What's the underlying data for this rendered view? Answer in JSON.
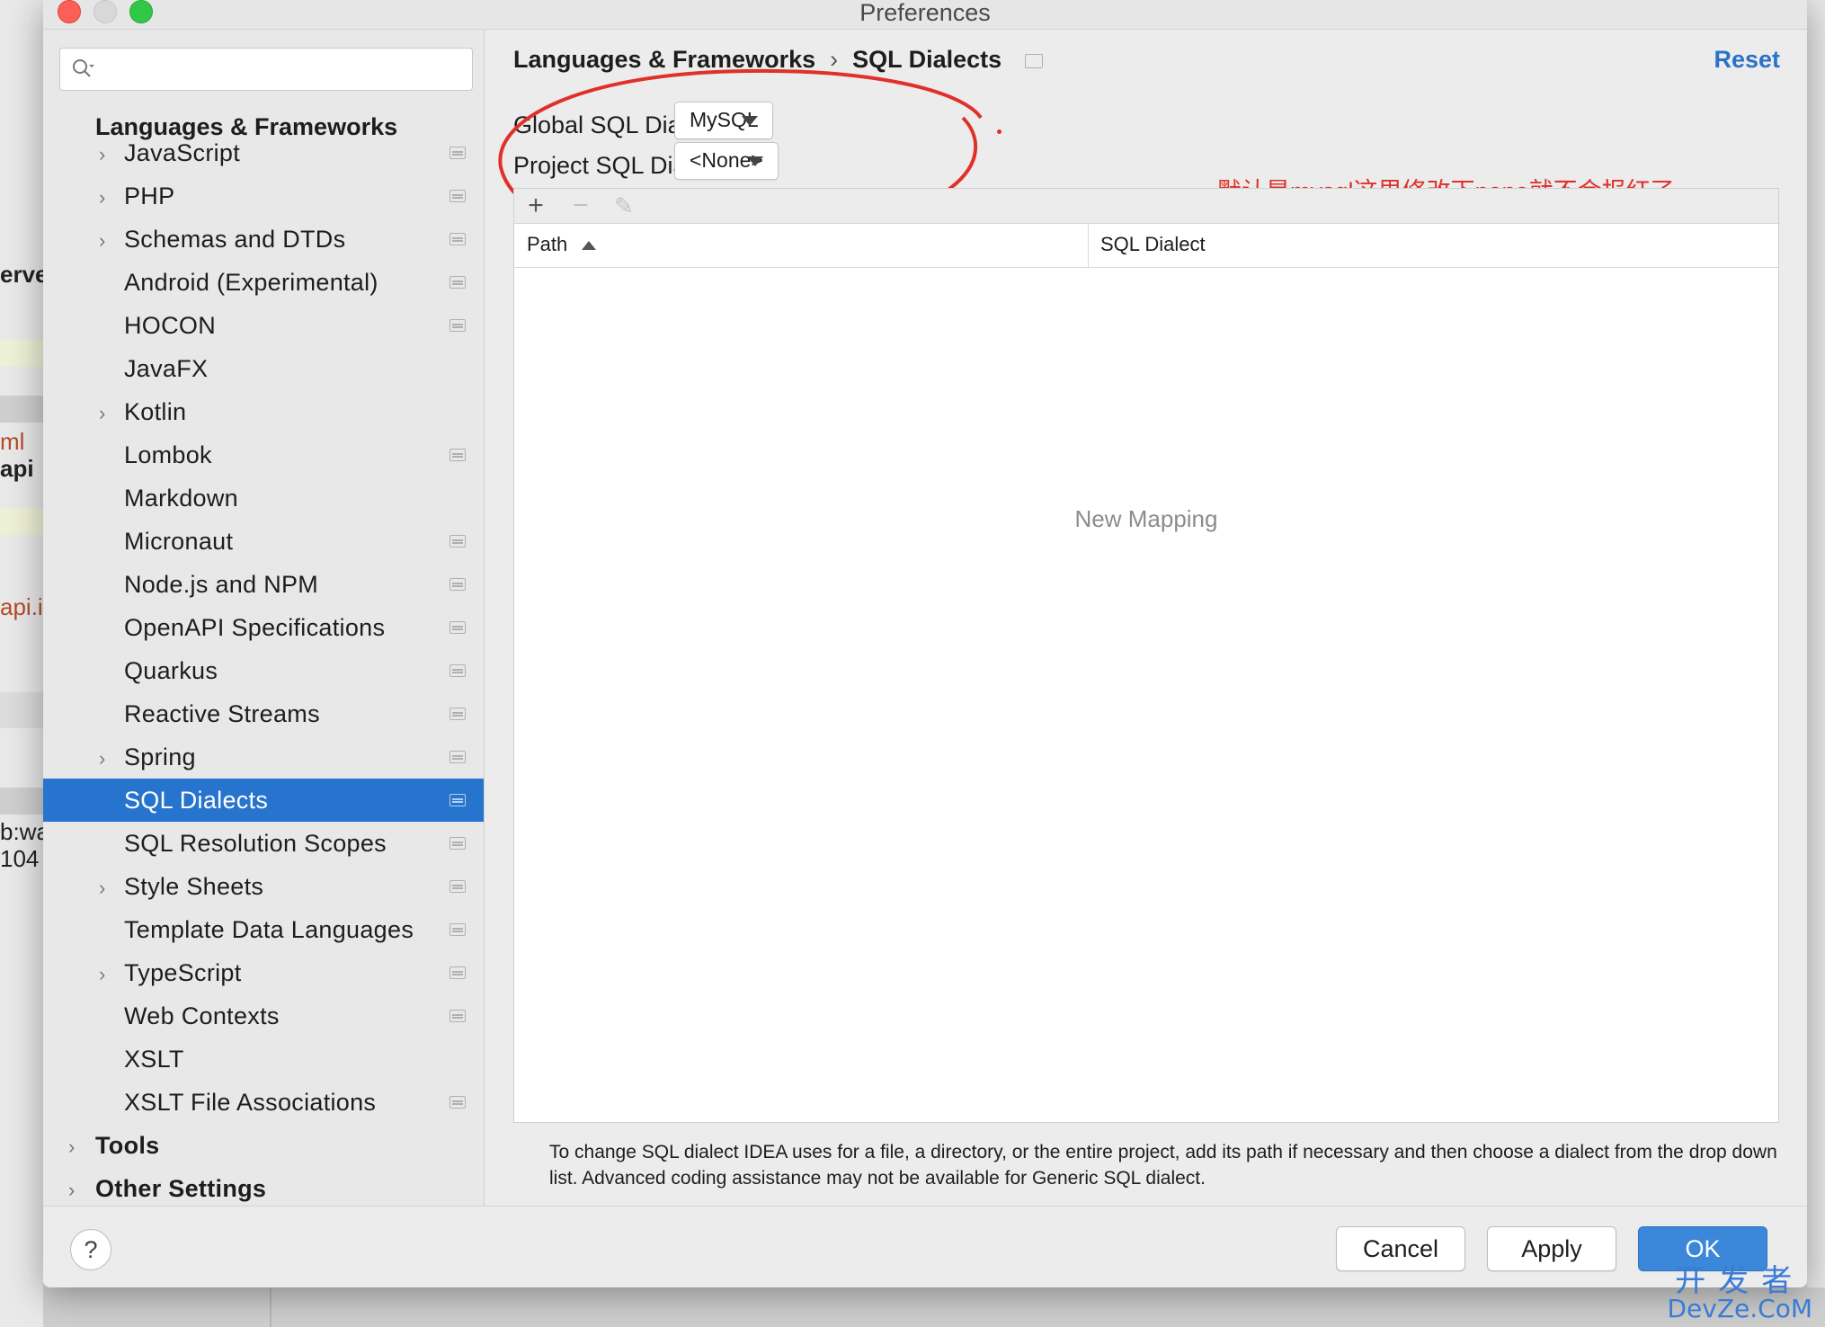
{
  "window": {
    "title": "Preferences"
  },
  "background_fragments": [
    "erve",
    "ml",
    "api",
    "api.i",
    "b:wa",
    "104"
  ],
  "sidebar": {
    "search": {
      "placeholder": ""
    },
    "section_title": "Languages & Frameworks",
    "items": [
      {
        "label": "JavaScript",
        "chevron": true,
        "page_icon": true,
        "selected": false
      },
      {
        "label": "PHP",
        "chevron": true,
        "page_icon": true,
        "selected": false
      },
      {
        "label": "Schemas and DTDs",
        "chevron": true,
        "page_icon": true,
        "selected": false
      },
      {
        "label": "Android (Experimental)",
        "chevron": false,
        "page_icon": true,
        "selected": false
      },
      {
        "label": "HOCON",
        "chevron": false,
        "page_icon": true,
        "selected": false
      },
      {
        "label": "JavaFX",
        "chevron": false,
        "page_icon": false,
        "selected": false
      },
      {
        "label": "Kotlin",
        "chevron": true,
        "page_icon": false,
        "selected": false
      },
      {
        "label": "Lombok",
        "chevron": false,
        "page_icon": true,
        "selected": false
      },
      {
        "label": "Markdown",
        "chevron": false,
        "page_icon": false,
        "selected": false
      },
      {
        "label": "Micronaut",
        "chevron": false,
        "page_icon": true,
        "selected": false
      },
      {
        "label": "Node.js and NPM",
        "chevron": false,
        "page_icon": true,
        "selected": false
      },
      {
        "label": "OpenAPI Specifications",
        "chevron": false,
        "page_icon": true,
        "selected": false
      },
      {
        "label": "Quarkus",
        "chevron": false,
        "page_icon": true,
        "selected": false
      },
      {
        "label": "Reactive Streams",
        "chevron": false,
        "page_icon": true,
        "selected": false
      },
      {
        "label": "Spring",
        "chevron": true,
        "page_icon": true,
        "selected": false
      },
      {
        "label": "SQL Dialects",
        "chevron": false,
        "page_icon": true,
        "selected": true
      },
      {
        "label": "SQL Resolution Scopes",
        "chevron": false,
        "page_icon": true,
        "selected": false
      },
      {
        "label": "Style Sheets",
        "chevron": true,
        "page_icon": true,
        "selected": false
      },
      {
        "label": "Template Data Languages",
        "chevron": false,
        "page_icon": true,
        "selected": false
      },
      {
        "label": "TypeScript",
        "chevron": true,
        "page_icon": true,
        "selected": false
      },
      {
        "label": "Web Contexts",
        "chevron": false,
        "page_icon": true,
        "selected": false
      },
      {
        "label": "XSLT",
        "chevron": false,
        "page_icon": false,
        "selected": false
      },
      {
        "label": "XSLT File Associations",
        "chevron": false,
        "page_icon": true,
        "selected": false
      }
    ],
    "top_level_items": [
      {
        "label": "Tools"
      },
      {
        "label": "Other Settings"
      }
    ]
  },
  "main": {
    "breadcrumb": {
      "parent": "Languages & Frameworks",
      "separator": "›",
      "current": "SQL Dialects"
    },
    "reset_label": "Reset",
    "global_dialect": {
      "label": "Global SQL Dialect:",
      "value": "MySQL"
    },
    "project_dialect": {
      "label": "Project SQL Dialect:",
      "value": "<None>"
    },
    "annotation_text": "默认是mysql这里修改下none就不会报红了",
    "table": {
      "toolbar": {
        "add": "+",
        "remove": "−",
        "edit": "✎"
      },
      "columns": [
        "Path",
        "SQL Dialect"
      ],
      "sort_column": "Path",
      "empty_text": "New Mapping"
    },
    "help_text": "To change SQL dialect IDEA uses for a file, a directory, or the entire project, add its path if necessary and then choose a dialect from the drop down list. Advanced coding assistance may not be available for Generic SQL dialect."
  },
  "footer": {
    "help_label": "?",
    "cancel_label": "Cancel",
    "apply_label": "Apply",
    "ok_label": "OK"
  },
  "watermark": {
    "line1": "开发者",
    "line2": "DevZe.CoM"
  },
  "colors": {
    "selection": "#2674cd",
    "reset_link": "#2a73c6",
    "annotation": "#e0302a",
    "ok_button": "#3b87d9"
  }
}
